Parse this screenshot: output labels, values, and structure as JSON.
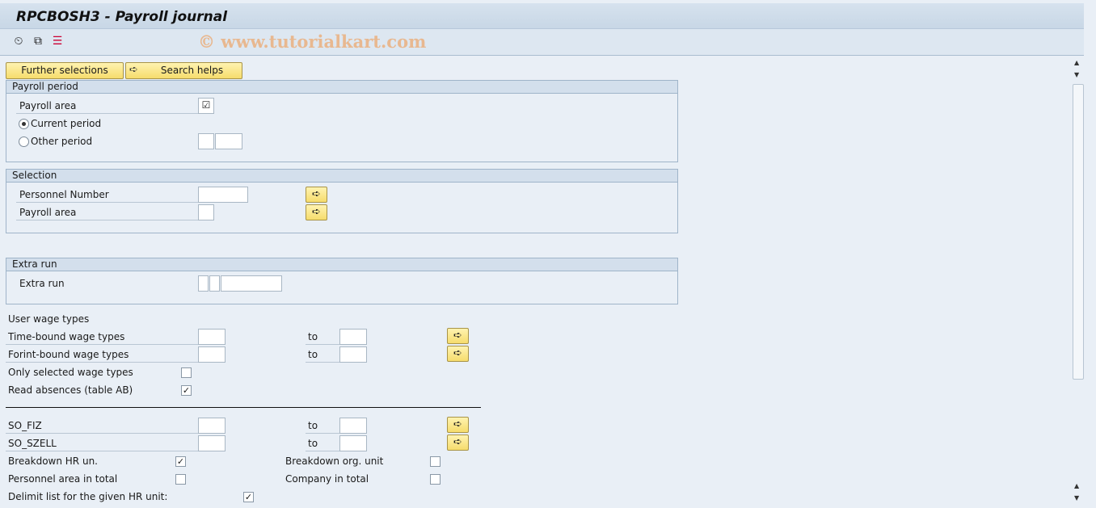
{
  "window": {
    "title": "RPCBOSH3 - Payroll journal",
    "watermark": "© www.tutorialkart.com"
  },
  "toolbar": {
    "icons": [
      "execute-icon",
      "get-variant-icon",
      "selection-options-icon"
    ]
  },
  "buttons": {
    "further_selections": "Further selections",
    "search_helps": "Search helps"
  },
  "payroll_period": {
    "title": "Payroll period",
    "payroll_area_label": "Payroll area",
    "payroll_area_checked": true,
    "current_period": "Current period",
    "other_period": "Other period",
    "selected": "Current period"
  },
  "selection": {
    "title": "Selection",
    "personnel_number": "Personnel Number",
    "payroll_area": "Payroll area"
  },
  "extra_run": {
    "title": "Extra run",
    "label": "Extra run"
  },
  "wage_types": {
    "heading": "User wage types",
    "time_bound": "Time-bound wage types",
    "forint_bound": "Forint-bound wage types",
    "to": "to",
    "only_selected": "Only selected wage types",
    "only_selected_checked": false,
    "read_absences": "Read absences (table AB)",
    "read_absences_checked": true
  },
  "other": {
    "so_fiz": "SO_FIZ",
    "so_szell": "SO_SZELL",
    "to": "to",
    "breakdown_hr": "Breakdown HR un.",
    "breakdown_hr_checked": true,
    "breakdown_org": "Breakdown org. unit",
    "breakdown_org_checked": false,
    "personnel_area_total": "Personnel area in total",
    "personnel_area_total_checked": false,
    "company_total": "Company in total",
    "company_total_checked": false,
    "delimit": "Delimit list for the given HR unit:",
    "delimit_checked": true
  }
}
